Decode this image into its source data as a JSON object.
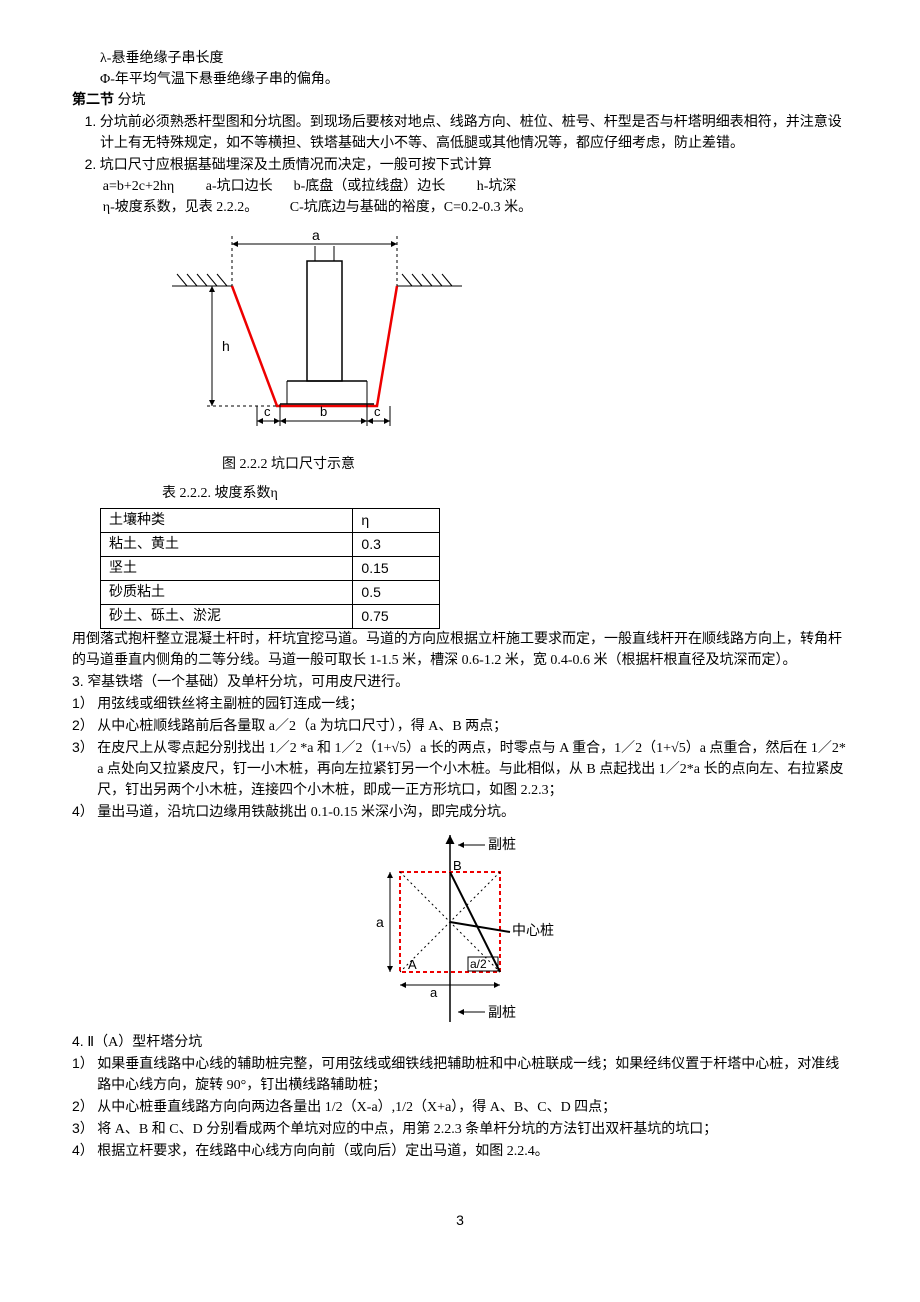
{
  "defs": {
    "lambda": "λ-悬垂绝缘子串长度",
    "phi": "Φ-年平均气温下悬垂绝缘子串的偏角。"
  },
  "section2": {
    "title_prefix": "第二节",
    "title_body": "   分坑",
    "item1": "分坑前必须熟悉杆型图和分坑图。到现场后要核对地点、线路方向、桩位、桩号、杆型是否与杆塔明细表相符，并注意设计上有无特殊规定，如不等横担、铁塔基础大小不等、高低腿或其他情况等，都应仔细考虑，防止差错。",
    "item1_num": "1.",
    "item2": "坑口尺寸应根据基础埋深及土质情况而决定，一般可按下式计算",
    "item2_num": "2.",
    "formula_line1": "a=b+2c+2hη         a-坑口边长      b-底盘（或拉线盘）边长         h-坑深",
    "formula_line2": "η-坡度系数，见表 2.2.2。         C-坑底边与基础的裕度，C=0.2-0.3 米。"
  },
  "fig222": {
    "a": "a",
    "h": "h",
    "c1": "c",
    "b": "b",
    "c2": "c",
    "caption": "图 2.2.2       坑口尺寸示意"
  },
  "table222": {
    "caption": "表 2.2.2. 坡度系数η",
    "header_soil": "土壤种类",
    "header_eta": "η",
    "rows": [
      {
        "soil": "粘土、黄土",
        "eta": "0.3"
      },
      {
        "soil": "坚土",
        "eta": "0.15"
      },
      {
        "soil": "砂质粘土",
        "eta": "0.5"
      },
      {
        "soil": "砂土、砾土、淤泥",
        "eta": "0.75"
      }
    ]
  },
  "after_table": "用倒落式抱杆整立混凝土杆时，杆坑宜挖马道。马道的方向应根据立杆施工要求而定，一般直线杆开在顺线路方向上，转角杆的马道垂直内侧角的二等分线。马道一般可取长 1-1.5 米，槽深 0.6-1.2 米，宽 0.4-0.6 米（根据杆根直径及坑深而定）。",
  "item3": {
    "num": "3.",
    "text": "窄基铁塔（一个基础）及单杆分坑，可用皮尺进行。",
    "sub1_num": "1）",
    "sub1": "用弦线或细铁丝将主副桩的园钉连成一线；",
    "sub2_num": "2）",
    "sub2": "从中心桩顺线路前后各量取 a／2（a 为坑口尺寸），得 A、B 两点；",
    "sub3_num": "3）",
    "sub3": "在皮尺上从零点起分别找出 1／2 *a 和 1／2（1+√5）a 长的两点，时零点与 A 重合，1／2（1+√5）a 点重合，然后在 1／2* a 点处向又拉紧皮尺，钉一小木桩，再向左拉紧钉另一个小木桩。与此相似，从 B 点起找出 1／2*a 长的点向左、右拉紧皮尺，钉出另两个小木桩，连接四个小木桩，即成一正方形坑口，如图 2.2.3；",
    "sub4_num": "4）",
    "sub4": "量出马道，沿坑口边缘用铁敲挑出 0.1-0.15 米深小沟，即完成分坑。"
  },
  "fig223": {
    "label_top": "副桩",
    "label_b": "B",
    "label_center": "中心桩",
    "label_a_left": "a",
    "label_A": "A",
    "label_a2": "a/2",
    "label_a_bottom": "a",
    "label_bottom": "副桩"
  },
  "item4": {
    "num": "4.",
    "text": "Ⅱ（A）型杆塔分坑",
    "sub1_num": "1）",
    "sub1": "如果垂直线路中心线的辅助桩完整，可用弦线或细铁线把辅助桩和中心桩联成一线；如果经纬仪置于杆塔中心桩，对准线路中心线方向，旋转 90°，钉出横线路辅助桩；",
    "sub2_num": "2）",
    "sub2": "从中心桩垂直线路方向向两边各量出 1/2（X-a）,1/2（X+a），得 A、B、C、D 四点；",
    "sub3_num": "3）",
    "sub3": "将 A、B 和 C、D 分别看成两个单坑对应的中点，用第 2.2.3 条单杆分坑的方法钉出双杆基坑的坑口；",
    "sub4_num": "4）",
    "sub4": "根据立杆要求，在线路中心线方向向前（或向后）定出马道，如图 2.2.4。"
  },
  "pagenum": "3"
}
